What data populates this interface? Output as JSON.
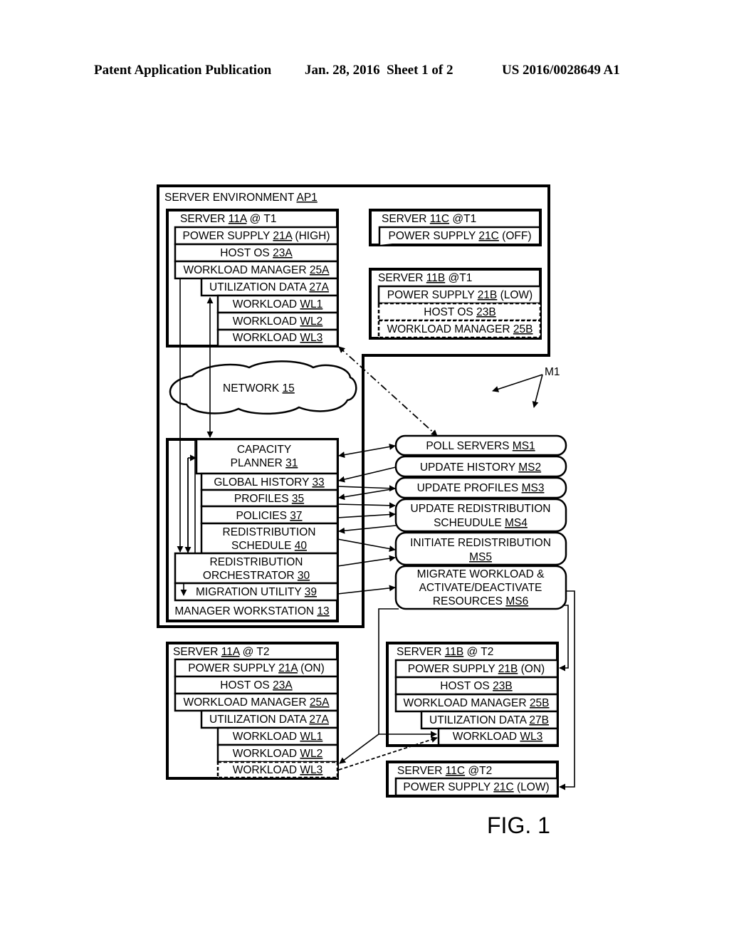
{
  "header": {
    "publication": "Patent Application Publication",
    "date_sheet": "Jan. 28, 2016  Sheet 1 of 2",
    "pub_number": "US 2016/0028649 A1"
  },
  "figure_label": "FIG. 1",
  "method_label": "M1",
  "environment": {
    "label": "SERVER ENVIRONMENT ",
    "ref": "AP1"
  },
  "network": {
    "label": "NETWORK ",
    "ref": "15"
  },
  "server_11a_t1": {
    "title": {
      "pre": "SERVER ",
      "ref": "11A",
      "post": " @ T1"
    },
    "rows": [
      {
        "pre": "POWER SUPPLY ",
        "ref": "21A",
        "post": " (HIGH)"
      },
      {
        "pre": "HOST OS ",
        "ref": "23A",
        "post": ""
      },
      {
        "pre": "WORKLOAD MANAGER ",
        "ref": "25A",
        "post": ""
      },
      {
        "pre": "UTILIZATION DATA ",
        "ref": "27A",
        "post": ""
      },
      {
        "pre": "WORKLOAD ",
        "ref": "WL1",
        "post": ""
      },
      {
        "pre": "WORKLOAD ",
        "ref": "WL2",
        "post": ""
      },
      {
        "pre": "WORKLOAD ",
        "ref": "WL3",
        "post": ""
      }
    ]
  },
  "server_11c_t1": {
    "title": {
      "pre": "SERVER ",
      "ref": "11C",
      "post": " @T1"
    },
    "rows": [
      {
        "pre": "POWER SUPPLY ",
        "ref": "21C",
        "post": " (OFF)"
      }
    ]
  },
  "server_11b_t1": {
    "title": {
      "pre": "SERVER ",
      "ref": "11B",
      "post": " @T1"
    },
    "rows": [
      {
        "pre": "POWER SUPPLY ",
        "ref": "21B",
        "post": " (LOW)"
      },
      {
        "pre": "HOST OS ",
        "ref": "23B",
        "post": ""
      },
      {
        "pre": "WORKLOAD MANAGER ",
        "ref": "25B",
        "post": ""
      }
    ]
  },
  "workstation": {
    "capacity_planner": {
      "line1": "CAPACITY",
      "pre": "PLANNER ",
      "ref": "31"
    },
    "global_history": {
      "pre": "GLOBAL HISTORY ",
      "ref": "33"
    },
    "profiles": {
      "pre": "PROFILES ",
      "ref": "35"
    },
    "policies": {
      "pre": "POLICIES ",
      "ref": "37"
    },
    "schedule": {
      "line1": "REDISTRIBUTION",
      "pre": "SCHEDULE ",
      "ref": "40"
    },
    "orchestrator": {
      "line1": "REDISTRIBUTION",
      "pre": "ORCHESTRATOR ",
      "ref": "30"
    },
    "migration": {
      "pre": "MIGRATION UTILITY ",
      "ref": "39"
    },
    "title": {
      "pre": "MANAGER WORKSTATION ",
      "ref": "13"
    }
  },
  "method_steps": [
    {
      "line1": "",
      "pre": "POLL SERVERS ",
      "ref": "MS1"
    },
    {
      "line1": "",
      "pre": "UPDATE HISTORY ",
      "ref": "MS2"
    },
    {
      "line1": "",
      "pre": "UPDATE PROFILES ",
      "ref": "MS3"
    },
    {
      "line1": "UPDATE REDISTRIBUTION",
      "pre": "SCHEUDULE ",
      "ref": "MS4"
    },
    {
      "line1": "INITIATE REDISTRIBUTION",
      "pre": "",
      "ref": "MS5"
    },
    {
      "line1": "MIGRATE WORKLOAD &",
      "line2": "ACTIVATE/DEACTIVATE",
      "pre": "RESOURCES ",
      "ref": "MS6"
    }
  ],
  "server_11a_t2": {
    "title": {
      "pre": "SERVER ",
      "ref": "11A",
      "post": " @ T2"
    },
    "rows": [
      {
        "pre": "POWER SUPPLY ",
        "ref": "21A",
        "post": " (ON)"
      },
      {
        "pre": "HOST OS ",
        "ref": "23A",
        "post": ""
      },
      {
        "pre": "WORKLOAD MANAGER ",
        "ref": "25A",
        "post": ""
      },
      {
        "pre": "UTILIZATION DATA ",
        "ref": "27A",
        "post": ""
      },
      {
        "pre": "WORKLOAD ",
        "ref": "WL1",
        "post": ""
      },
      {
        "pre": "WORKLOAD ",
        "ref": "WL2",
        "post": ""
      },
      {
        "pre": "WORKLOAD ",
        "ref": "WL3",
        "post": ""
      }
    ]
  },
  "server_11b_t2": {
    "title": {
      "pre": "SERVER ",
      "ref": "11B",
      "post": " @ T2"
    },
    "rows": [
      {
        "pre": "POWER SUPPLY ",
        "ref": "21B",
        "post": " (ON)"
      },
      {
        "pre": "HOST OS ",
        "ref": "23B",
        "post": ""
      },
      {
        "pre": "WORKLOAD MANAGER ",
        "ref": "25B",
        "post": ""
      },
      {
        "pre": "UTILIZATION DATA ",
        "ref": "27B",
        "post": ""
      },
      {
        "pre": "WORKLOAD ",
        "ref": "WL3",
        "post": ""
      }
    ]
  },
  "server_11c_t2": {
    "title": {
      "pre": "SERVER ",
      "ref": "11C",
      "post": " @T2"
    },
    "rows": [
      {
        "pre": "POWER SUPPLY ",
        "ref": "21C",
        "post": " (LOW)"
      }
    ]
  }
}
